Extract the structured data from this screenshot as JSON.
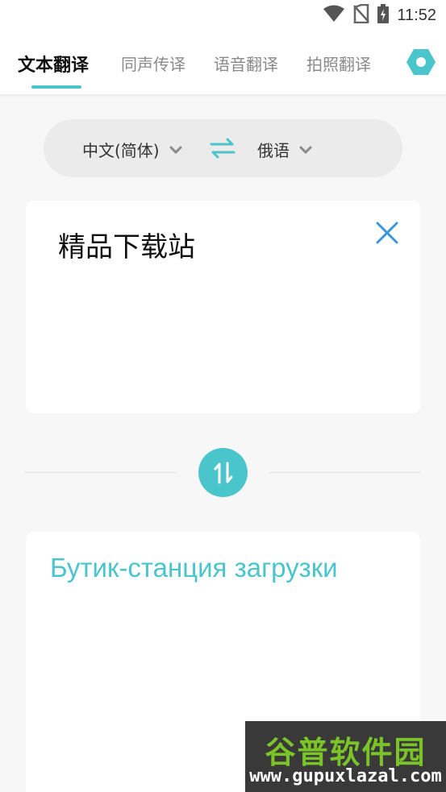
{
  "status_bar": {
    "time": "11:52",
    "icons": [
      "wifi-icon",
      "no-sim-icon",
      "battery-charging-icon"
    ]
  },
  "tabs": [
    {
      "label": "文本翻译",
      "active": true
    },
    {
      "label": "同声传译",
      "active": false
    },
    {
      "label": "语音翻译",
      "active": false
    },
    {
      "label": "拍照翻译",
      "active": false
    }
  ],
  "settings_icon": "settings-hexagon-icon",
  "language_selector": {
    "source": "中文(简体)",
    "target": "俄语",
    "swap_icon": "swap-arrows-icon",
    "dropdown_icon": "chevron-down-icon"
  },
  "input": {
    "text": "精品下载站",
    "clear_icon": "close-icon"
  },
  "exchange_icon": "up-down-arrows-icon",
  "output": {
    "text": "Бутик-станция загрузки"
  },
  "watermark": {
    "title": "谷普软件园",
    "url": "www.gupuxlazal.com"
  },
  "colors": {
    "accent": "#4ac5cc",
    "clear_icon": "#3b95d9",
    "watermark_green": "#7bc428"
  }
}
